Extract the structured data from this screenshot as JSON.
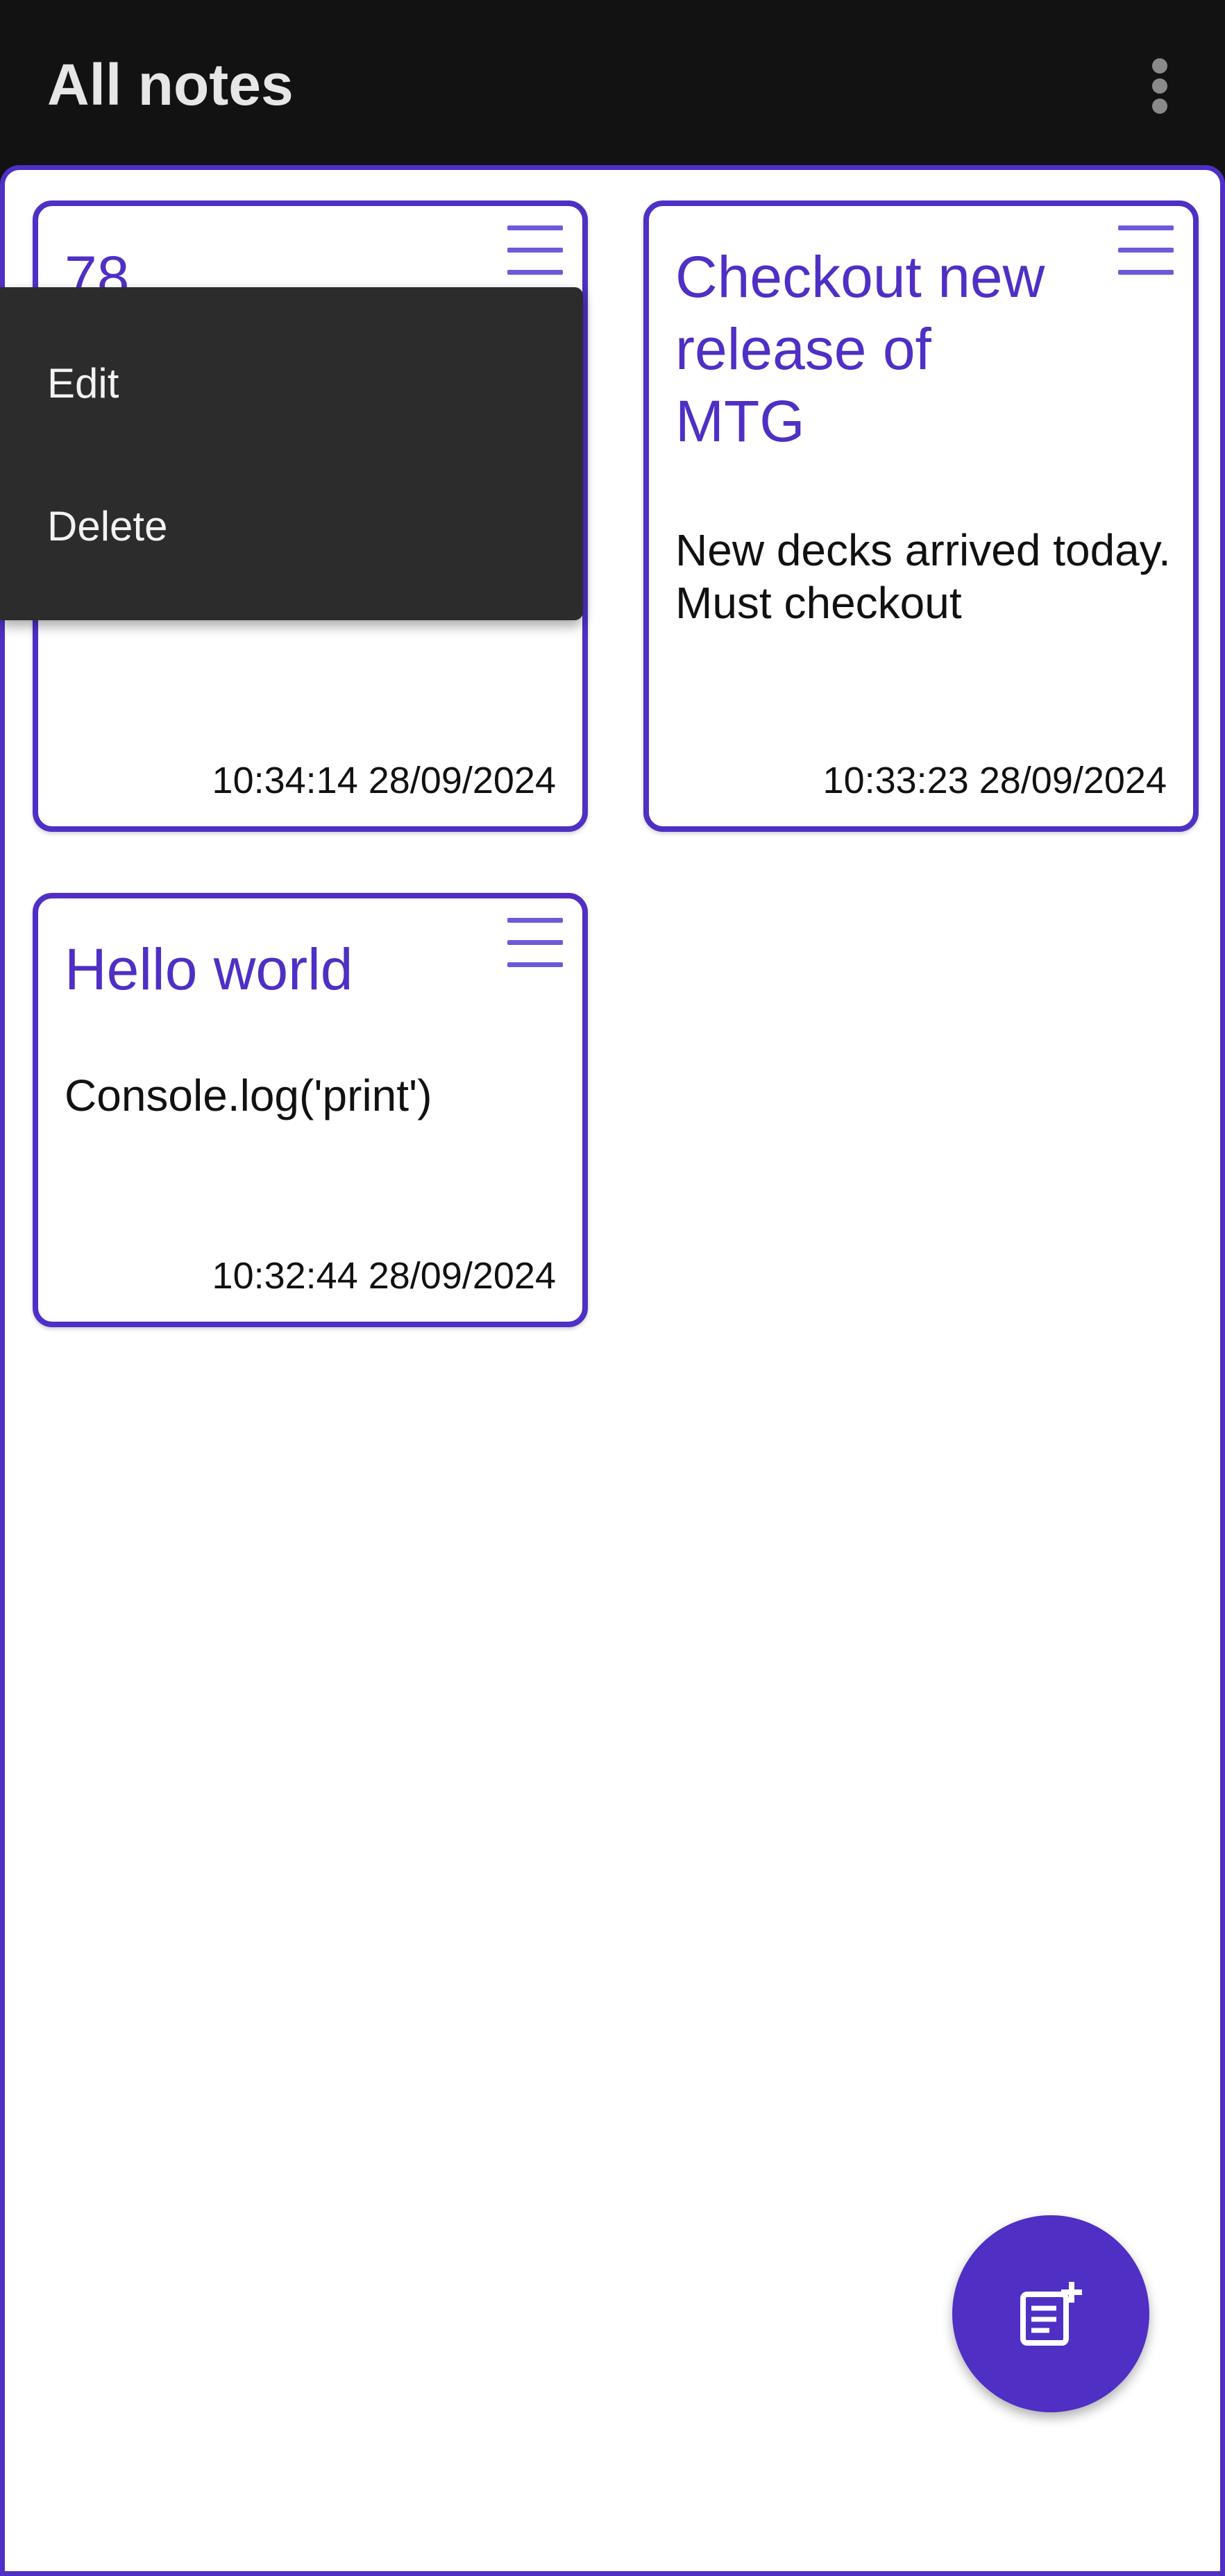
{
  "app_bar": {
    "title": "All notes",
    "overflow_icon": "more-vert-icon"
  },
  "notes": [
    {
      "title": "78",
      "body": "",
      "timestamp": "10:34:14 28/09/2024",
      "menu_icon": "hamburger-menu-icon"
    },
    {
      "title": "Checkout new release of MTG",
      "body": "New decks arrived today. Must checkout",
      "timestamp": "10:33:23 28/09/2024",
      "menu_icon": "hamburger-menu-icon"
    },
    {
      "title": "Hello world",
      "body": "Console.log('print')",
      "timestamp": "10:32:44 28/09/2024",
      "menu_icon": "hamburger-menu-icon"
    }
  ],
  "context_menu": {
    "items": [
      {
        "label": "Edit"
      },
      {
        "label": "Delete"
      }
    ]
  },
  "fab": {
    "icon": "add-note-icon"
  },
  "colors": {
    "accent": "#4f2fc4",
    "menu_lines": "#6d5ad8",
    "app_bar_bg": "#121212",
    "popup_bg": "#2c2c2c"
  }
}
